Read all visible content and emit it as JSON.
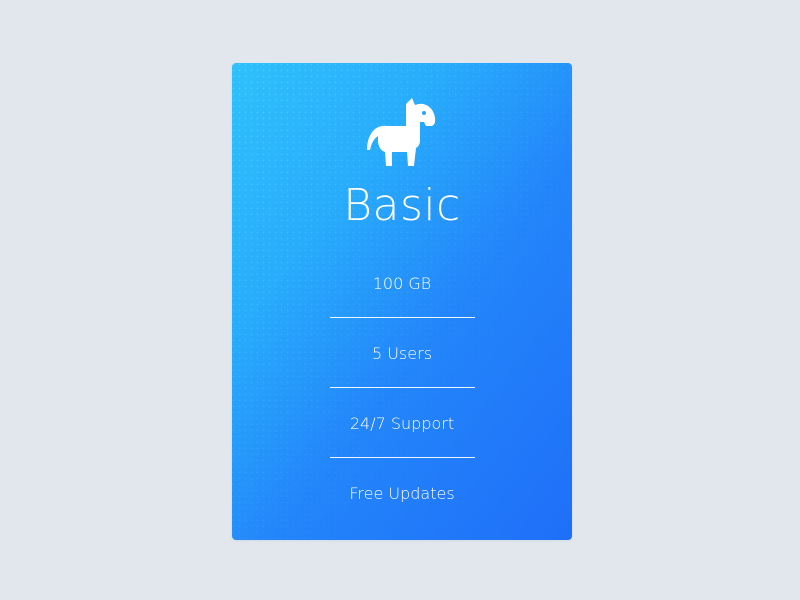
{
  "plan": {
    "icon": "horse-icon",
    "name": "Basic",
    "features": [
      "100 GB",
      "5 Users",
      "24/7 Support",
      "Free Updates"
    ]
  },
  "colors": {
    "page_background": "#e2e7ed",
    "card_gradient_start": "#2fc1fb",
    "card_gradient_end": "#1f6ff8",
    "text": "#ffffff"
  }
}
